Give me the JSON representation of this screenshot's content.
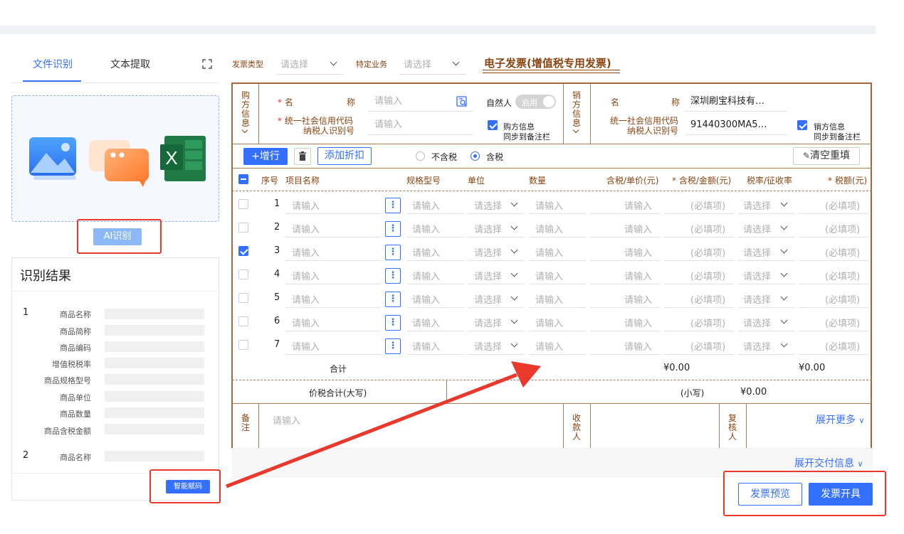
{
  "left_panel": {
    "tabs": [
      "文件识别",
      "文本提取"
    ],
    "ai_button": "AI识别",
    "result_title": "识别结果",
    "items": [
      {
        "no": "1",
        "fields": [
          "商品名称",
          "商品简称",
          "商品编码",
          "增值税税率",
          "商品规格型号",
          "商品单位",
          "商品数量",
          "商品含税金额"
        ]
      },
      {
        "no": "2",
        "fields": [
          "商品名称"
        ]
      }
    ],
    "smart_button": "智能赋码",
    "upload_icons": [
      "image-icon",
      "chat-bubbles-icon",
      "excel-icon"
    ]
  },
  "header": {
    "invoice_type_label": "发票类型",
    "invoice_type_placeholder": "请选择",
    "special_business_label": "特定业务",
    "special_business_placeholder": "请选择",
    "invoice_title": "电子发票(增值税专用发票)"
  },
  "buyer": {
    "section_label": "购方信息",
    "name_label": "名",
    "name_label2": "称",
    "name_placeholder": "请输入",
    "credit_code_label": "统一社会信用代码",
    "taxpayer_id_label": "纳税人识别号",
    "credit_placeholder": "请输入",
    "natural_person_label": "自然人",
    "natural_person_toggle": "启用",
    "sync_label_1": "购方信息",
    "sync_label_2": "同步到备注栏"
  },
  "seller": {
    "section_label": "销方信息",
    "name_label": "名",
    "name_label2": "称",
    "name_value": "深圳刷宝科技有…",
    "credit_code_label": "统一社会信用代码",
    "taxpayer_id_label": "纳税人识别号",
    "credit_value": "91440300MA5…",
    "sync_label_1": "销方信息",
    "sync_label_2": "同步到备注栏"
  },
  "toolbar": {
    "add_row": "+增行",
    "add_discount": "添加折扣",
    "tax_excluded": "不含税",
    "tax_included": "含税",
    "clear": "清空重填"
  },
  "table": {
    "headers": [
      "序号",
      "项目名称",
      "规格型号",
      "单位",
      "数量",
      "含税/单价(元)",
      "* 含税/金额(元)",
      "税率/征收率",
      "* 税额(元)"
    ],
    "rows": [
      {
        "no": "1",
        "checked": false
      },
      {
        "no": "2",
        "checked": false
      },
      {
        "no": "3",
        "checked": true
      },
      {
        "no": "4",
        "checked": false
      },
      {
        "no": "5",
        "checked": false
      },
      {
        "no": "6",
        "checked": false
      },
      {
        "no": "7",
        "checked": false
      }
    ],
    "input_placeholder": "请输入",
    "select_placeholder": "请选择",
    "required_placeholder": "(必填项)",
    "total_label": "合计",
    "total_amount": "¥0.00",
    "total_tax": "¥0.00",
    "price_tax_total_label": "价税合计(大写)",
    "lowercase_label": "(小写)",
    "lowercase_value": "¥0.00"
  },
  "remarks": {
    "remark_label": "备注",
    "remark_placeholder": "请输入",
    "payee_label": "收款人",
    "reviewer_label": "复核人",
    "expand_more": "展开更多"
  },
  "footer": {
    "expand_delivery": "展开交付信息",
    "preview_button": "发票预览",
    "issue_button": "发票开具"
  },
  "colors": {
    "accent": "#3370ff",
    "frame": "#a9673d",
    "highlight": "#e8392c"
  }
}
